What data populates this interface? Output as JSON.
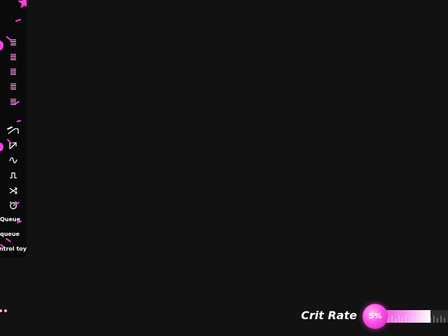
{
  "toolbar": {
    "menu_items": [
      "menu",
      "menu",
      "menu",
      "menu",
      "menu"
    ],
    "tools": [
      "ramp",
      "arrow",
      "sine",
      "square",
      "shuffle",
      "timer"
    ],
    "text_items": [
      "Queue",
      "queue",
      "ntrol toy"
    ]
  },
  "stats": {
    "label": "Crit Rate",
    "value_text": "5%",
    "value": 0.05
  },
  "colors": {
    "accent": "#ff3fe0",
    "accent_light": "#ff9ff3",
    "background": "#121212",
    "panel": "#0a0a0a",
    "text": "#ffffff",
    "menu_pink": "#ff6fd8"
  }
}
